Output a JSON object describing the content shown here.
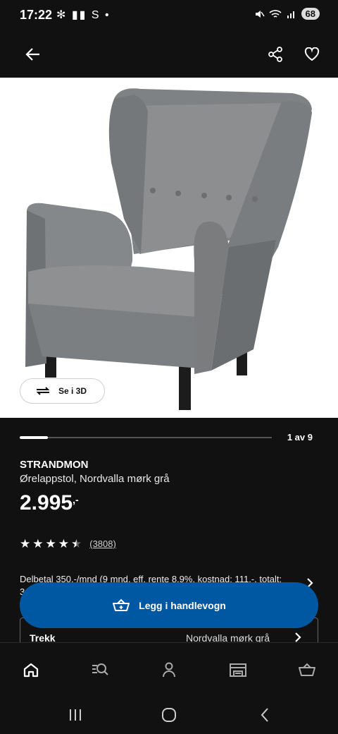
{
  "status_bar": {
    "time": "17:22",
    "left_icons": "✻ ▮▮ S •",
    "battery": "68"
  },
  "product": {
    "view_3d_label": "Se i 3D",
    "gallery_count": "1 av 9",
    "gallery_progress": 0.111,
    "name": "STRANDMON",
    "description": "Ørelappstol, Nordvalla mørk grå",
    "price": "2.995",
    "price_suffix": ",-",
    "rating": 4.5,
    "rating_count": "(3808)",
    "installment_text": "Delbetal 350,-/mnd (9 mnd, eff. rente 8.9%, kostnad: 111,-, totalt: 3.106,-)"
  },
  "option": {
    "label": "Trekk",
    "value": "Nordvalla mørk grå"
  },
  "cta": {
    "add_to_cart_label": "Legg i handlevogn"
  },
  "bottom_nav": {
    "items": [
      "home-icon",
      "search-list-icon",
      "profile-icon",
      "store-icon",
      "basket-icon"
    ]
  },
  "colors": {
    "background": "#111111",
    "accent_blue": "#0058a3",
    "chair_grey": "#8a8c8e"
  }
}
